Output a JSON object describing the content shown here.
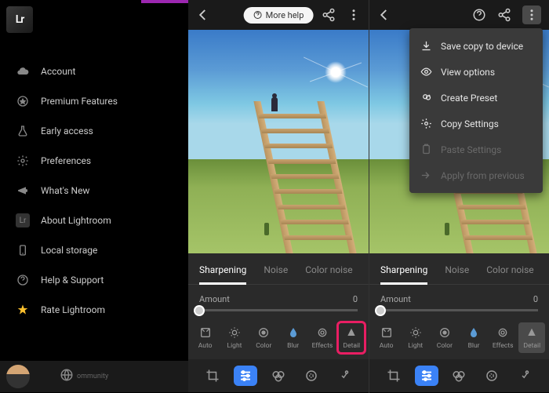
{
  "logo": "Lr",
  "menu": {
    "items": [
      {
        "label": "Account",
        "icon": "cloud"
      },
      {
        "label": "Premium Features",
        "icon": "star-circle"
      },
      {
        "label": "Early access",
        "icon": "flask"
      },
      {
        "label": "Preferences",
        "icon": "gear"
      },
      {
        "label": "What's New",
        "icon": "megaphone"
      },
      {
        "label": "About Lightroom",
        "icon": "lr"
      },
      {
        "label": "Local storage",
        "icon": "phone"
      },
      {
        "label": "Help & Support",
        "icon": "help"
      },
      {
        "label": "Rate Lightroom",
        "icon": "star"
      }
    ],
    "bottom_label": "ommunity"
  },
  "more_help": "More help",
  "tabs": {
    "items": [
      {
        "label": "Sharpening",
        "active": true
      },
      {
        "label": "Noise",
        "active": false
      },
      {
        "label": "Color noise",
        "active": false
      }
    ]
  },
  "slider": {
    "label": "Amount",
    "value": "0"
  },
  "tools": [
    {
      "label": "Auto",
      "icon": "auto"
    },
    {
      "label": "Light",
      "icon": "light"
    },
    {
      "label": "Color",
      "icon": "color"
    },
    {
      "label": "Blur",
      "icon": "blur"
    },
    {
      "label": "Effects",
      "icon": "effects"
    },
    {
      "label": "Detail",
      "icon": "detail"
    }
  ],
  "dropdown": {
    "items": [
      {
        "label": "Save copy to device",
        "icon": "download",
        "disabled": false
      },
      {
        "label": "View options",
        "icon": "eye",
        "disabled": false
      },
      {
        "label": "Create Preset",
        "icon": "preset",
        "disabled": false
      },
      {
        "label": "Copy Settings",
        "icon": "copy",
        "disabled": false
      },
      {
        "label": "Paste Settings",
        "icon": "paste",
        "disabled": true
      },
      {
        "label": "Apply from previous",
        "icon": "apply",
        "disabled": true
      }
    ]
  }
}
